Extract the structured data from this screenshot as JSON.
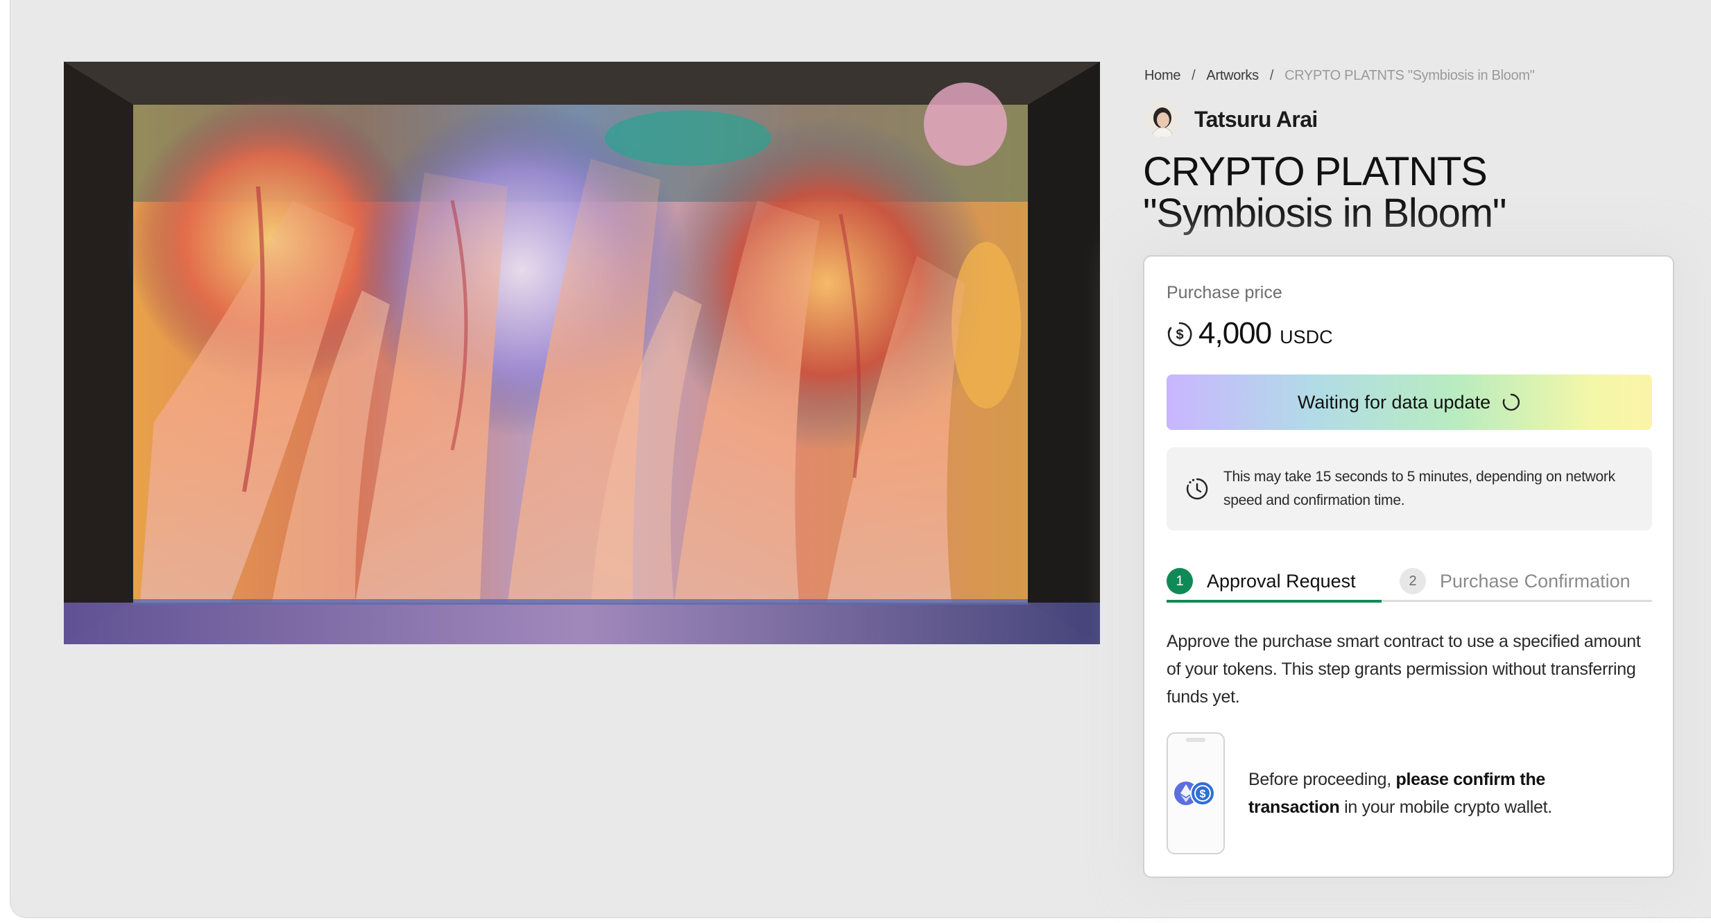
{
  "breadcrumb": {
    "home": "Home",
    "separator_1": "/",
    "artworks": "Artworks",
    "separator_2": "/",
    "current": "CRYPTO PLATNTS \"Symbiosis in Bloom\""
  },
  "artist": {
    "name": "Tatsuru Arai",
    "avatar_icon": "artist-avatar"
  },
  "artwork": {
    "title_line_1": "CRYPTO PLATNTS",
    "title_line_2": "\"Symbiosis in Bloom\""
  },
  "purchase": {
    "price_label": "Purchase price",
    "price_icon": "dollar-coin-icon",
    "price_value": "4,000",
    "price_unit": "USDC",
    "status_label": "Waiting for data update",
    "status_icon": "loading-spinner-icon",
    "notice_icon": "clock-icon",
    "notice_text": "This may take 15 seconds to 5 minutes, depending on network speed and confirmation time."
  },
  "steps": [
    {
      "number": "1",
      "label": "Approval Request",
      "state": "active"
    },
    {
      "number": "2",
      "label": "Purchase Confirmation",
      "state": "inactive"
    }
  ],
  "step_content": {
    "description": "Approve the purchase smart contract to use a specified amount of your tokens. This step grants permission without transferring funds yet.",
    "confirm_prefix": "Before proceeding, ",
    "confirm_bold": "please confirm the transaction",
    "confirm_suffix": " in your mobile crypto wallet.",
    "wallet_icons": [
      "ethereum-icon",
      "usdc-icon"
    ]
  },
  "colors": {
    "accent_green": "#0f8a56",
    "status_gradient": [
      "#c9b6ff",
      "#b2dbe7",
      "#b9ecbf",
      "#f4f7a8"
    ],
    "page_background": "#e9e9e9"
  }
}
